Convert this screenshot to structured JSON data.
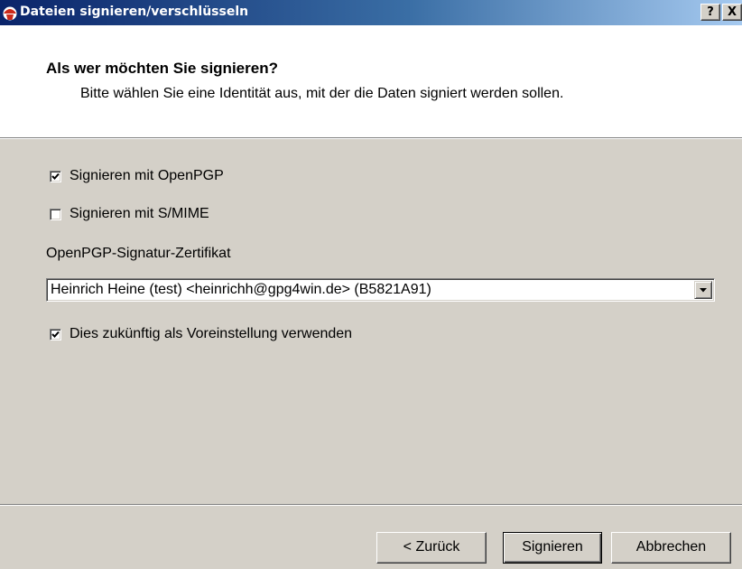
{
  "window": {
    "title": "Dateien signieren/verschlüsseln",
    "help_label": "?",
    "close_label": "X",
    "title_icon": "gpg4win-kleopatra-icon"
  },
  "header": {
    "title": "Als wer möchten Sie signieren?",
    "subtitle": "Bitte wählen Sie eine Identität aus, mit der die Daten signiert werden sollen."
  },
  "options": {
    "openpgp": {
      "label": "Signieren mit OpenPGP",
      "checked": true
    },
    "smime": {
      "label": "Signieren mit S/MIME",
      "checked": false
    },
    "default": {
      "label": "Dies zukünftig als Voreinstellung verwenden",
      "checked": true
    }
  },
  "certificate": {
    "label": "OpenPGP-Signatur-Zertifikat",
    "selected": "Heinrich Heine (test) <heinrichh@gpg4win.de> (B5821A91)"
  },
  "buttons": {
    "back": "< Zurück",
    "sign": "Signieren",
    "cancel": "Abbrechen"
  }
}
